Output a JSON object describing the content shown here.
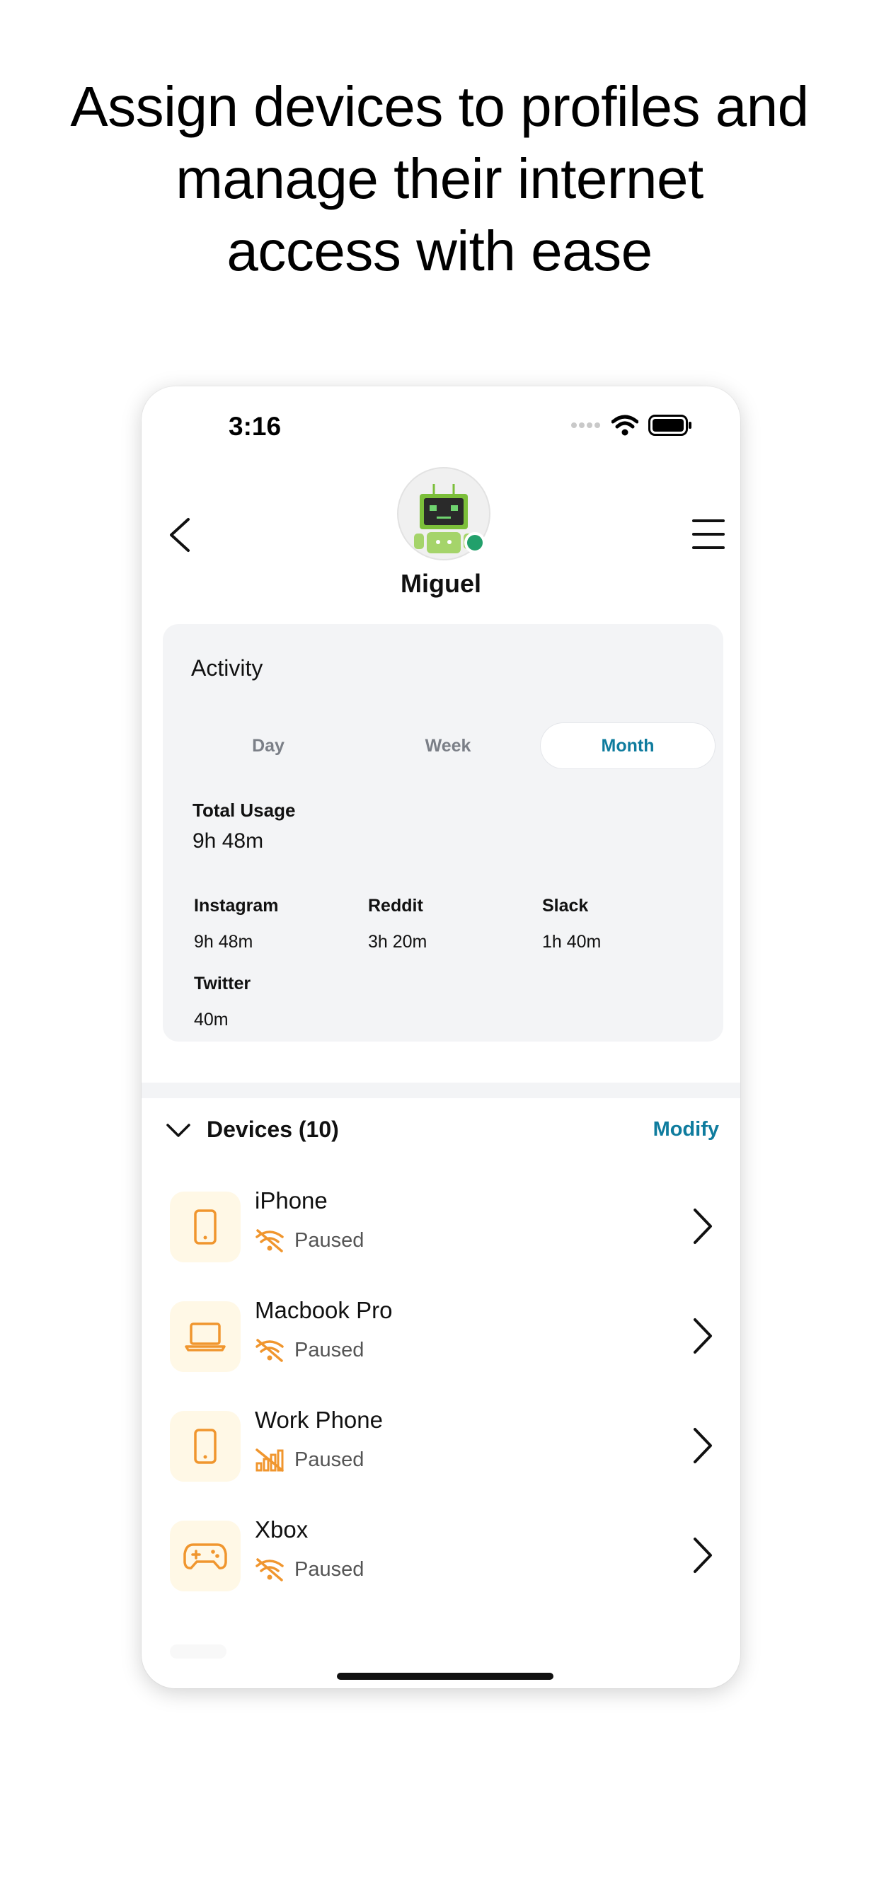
{
  "headline": {
    "line1": "Assign devices to profiles and",
    "line2": "manage their internet",
    "line3": "access with ease"
  },
  "status_bar": {
    "time": "3:16"
  },
  "profile": {
    "name": "Miguel",
    "avatar_icon": "robot-avatar-icon",
    "status_color": "#22a06b"
  },
  "activity": {
    "title": "Activity",
    "tabs": [
      {
        "label": "Day",
        "active": false
      },
      {
        "label": "Week",
        "active": false
      },
      {
        "label": "Month",
        "active": true
      }
    ],
    "total_usage_label": "Total Usage",
    "total_usage_value": "9h 48m",
    "apps": [
      {
        "name": "Instagram",
        "time": "9h 48m"
      },
      {
        "name": "Reddit",
        "time": "3h 20m"
      },
      {
        "name": "Slack",
        "time": "1h 40m"
      },
      {
        "name": "Twitter",
        "time": "40m"
      }
    ]
  },
  "devices": {
    "title": "Devices (10)",
    "modify_label": "Modify",
    "items": [
      {
        "name": "iPhone",
        "status": "Paused",
        "icon": "phone-icon",
        "status_icon": "wifi-off-icon"
      },
      {
        "name": "Macbook Pro",
        "status": "Paused",
        "icon": "laptop-icon",
        "status_icon": "wifi-off-icon"
      },
      {
        "name": "Work Phone",
        "status": "Paused",
        "icon": "phone-icon",
        "status_icon": "cellular-off-icon"
      },
      {
        "name": "Xbox",
        "status": "Paused",
        "icon": "gamepad-icon",
        "status_icon": "wifi-off-icon"
      }
    ]
  },
  "colors": {
    "accent": "#0f7c9e",
    "device_icon": "#f0962e",
    "device_icon_bg": "#fff8e6",
    "card_bg": "#f3f4f6"
  }
}
